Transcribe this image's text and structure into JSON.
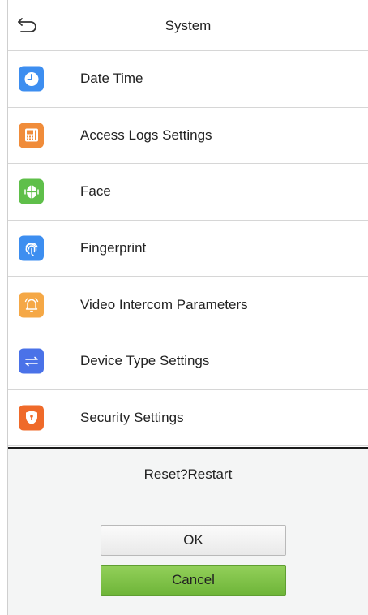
{
  "header": {
    "title": "System",
    "back_icon": "back-arrow-icon"
  },
  "menu": {
    "items": [
      {
        "label": "Date Time",
        "icon": "clock-icon",
        "color": "#3d8ef0"
      },
      {
        "label": "Access Logs Settings",
        "icon": "access-logs-icon",
        "color": "#f08c3a"
      },
      {
        "label": "Face",
        "icon": "face-icon",
        "color": "#5fbf4a"
      },
      {
        "label": "Fingerprint",
        "icon": "fingerprint-icon",
        "color": "#3d8ef0"
      },
      {
        "label": "Video Intercom Parameters",
        "icon": "bell-icon",
        "color": "#f5a846"
      },
      {
        "label": "Device Type Settings",
        "icon": "transfer-icon",
        "color": "#4a72e8"
      },
      {
        "label": "Security Settings",
        "icon": "shield-icon",
        "color": "#ef6a2a"
      }
    ]
  },
  "dialog": {
    "message": "Reset?Restart",
    "ok_label": "OK",
    "cancel_label": "Cancel",
    "cancel_color": "#7dc245"
  }
}
